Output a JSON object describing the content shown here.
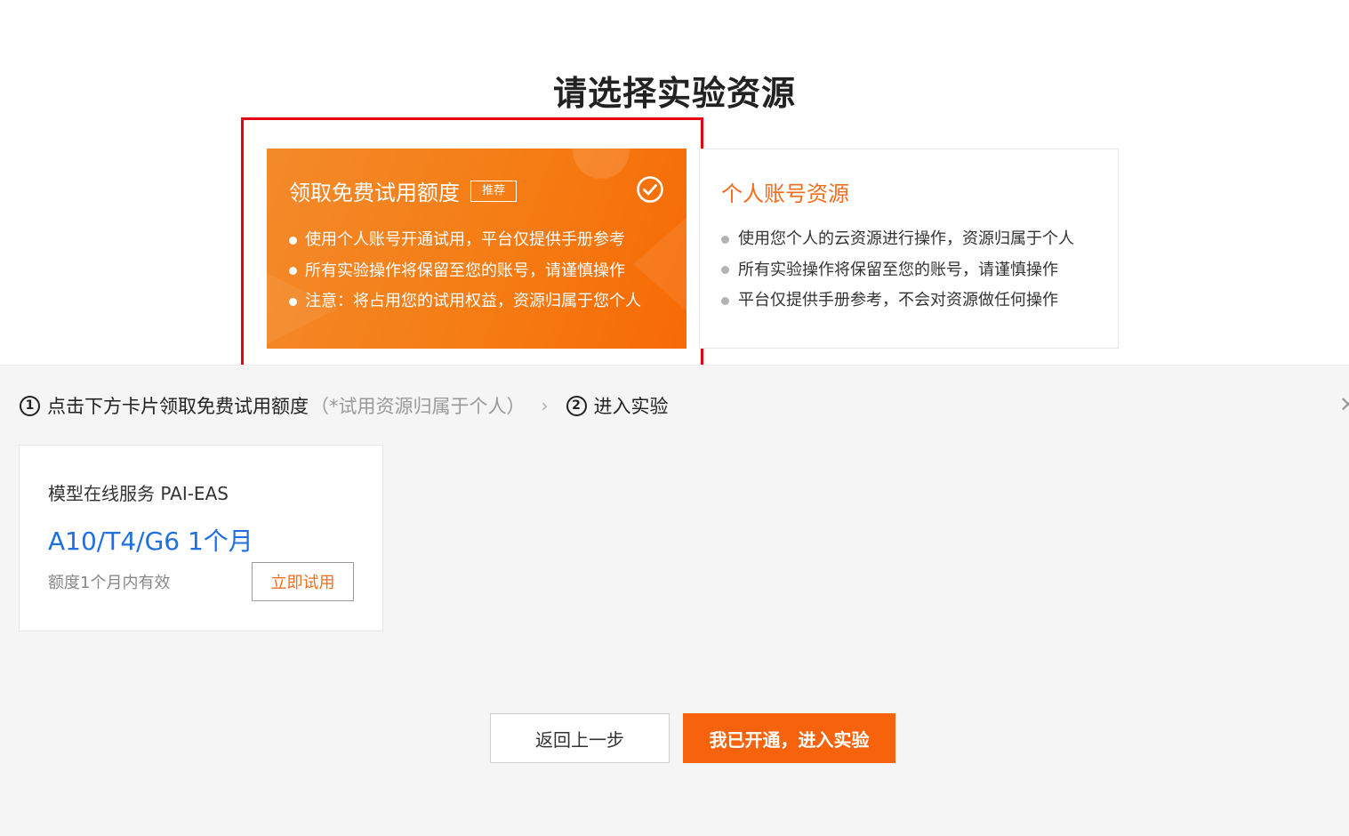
{
  "page": {
    "title": "请选择实验资源"
  },
  "free_trial_card": {
    "title": "领取免费试用额度",
    "badge": "推荐",
    "items": [
      "使用个人账号开通试用，平台仅提供手册参考",
      "所有实验操作将保留至您的账号，请谨慎操作",
      "注意：将占用您的试用权益，资源归属于您个人"
    ],
    "selected_icon": "check-circle-icon",
    "color": "#f57c14"
  },
  "personal_card": {
    "title": "个人账号资源",
    "items": [
      "使用您个人的云资源进行操作，资源归属于个人",
      "所有实验操作将保留至您的账号，请谨慎操作",
      "平台仅提供手册参考，不会对资源做任何操作"
    ],
    "title_color": "#f36d1c"
  },
  "steps": {
    "step1_num": "1",
    "step1_label": "点击下方卡片领取免费试用额度",
    "step1_hint": "（*试用资源归属于个人）",
    "separator": "›",
    "step2_num": "2",
    "step2_label": "进入实验"
  },
  "resource": {
    "name": "模型在线服务 PAI-EAS",
    "spec": "A10/T4/G6 1个月",
    "validity": "额度1个月内有效",
    "try_label": "立即试用",
    "spec_color": "#1f6fe0"
  },
  "footer": {
    "back_label": "返回上一步",
    "enter_label": "我已开通，进入实验",
    "enter_color": "#f7630c"
  }
}
